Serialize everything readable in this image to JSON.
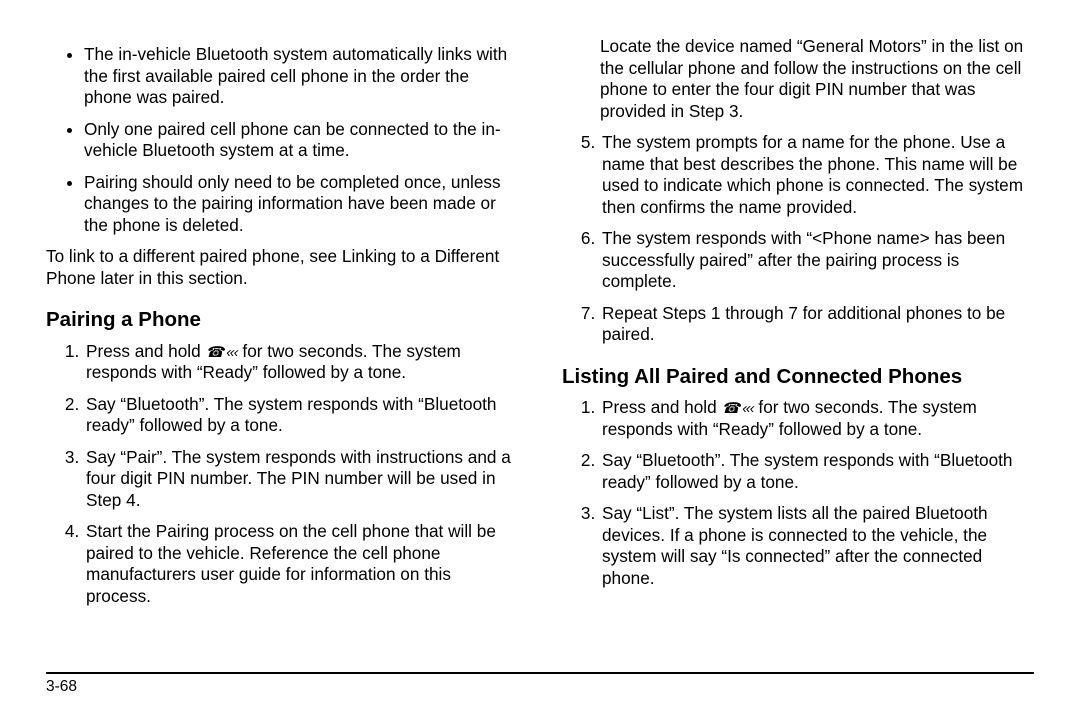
{
  "left": {
    "bullets": [
      "The in-vehicle Bluetooth system automatically links with the first available paired cell phone in the order the phone was paired.",
      "Only one paired cell phone can be connected to the in-vehicle Bluetooth system at a time.",
      "Pairing should only need to be completed once, unless changes to the pairing information have been made or the phone is deleted."
    ],
    "paragraph": "To link to a different paired phone, see Linking to a Different Phone later in this section.",
    "heading": "Pairing a Phone",
    "step1_a": "Press and hold ",
    "step1_b": " for two seconds. The system responds with “Ready” followed by a tone.",
    "steps_rest": [
      "Say “Bluetooth”. The system responds with “Bluetooth ready” followed by a tone.",
      "Say “Pair”. The system responds with instructions and a four digit PIN number. The PIN number will be used in Step 4.",
      "Start the Pairing process on the cell phone that will be paired to the vehicle. Reference the cell phone manufacturers user guide for information on this process."
    ]
  },
  "right": {
    "cont": "Locate the device named “General Motors” in the list on the cellular phone and follow the instructions on the cell phone to enter the four digit PIN number that was provided in Step 3.",
    "steps": [
      "The system prompts for a name for the phone. Use a name that best describes the phone. This name will be used to indicate which phone is connected. The system then confirms the name provided.",
      "The system responds with “<Phone name> has been successfully paired” after the pairing process is complete.",
      "Repeat Steps 1 through 7 for additional phones to be paired."
    ],
    "heading": "Listing All Paired and Connected Phones",
    "list1_a": "Press and hold ",
    "list1_b": " for two seconds. The system responds with “Ready” followed by a tone.",
    "list_rest": [
      "Say “Bluetooth”. The system responds with “Bluetooth ready” followed by a tone.",
      "Say “List”. The system lists all the paired Bluetooth devices. If a phone is connected to the vehicle, the system will say “Is connected” after the connected phone."
    ]
  },
  "icons": {
    "talk": "☎ «‹"
  },
  "page_number": "3-68"
}
